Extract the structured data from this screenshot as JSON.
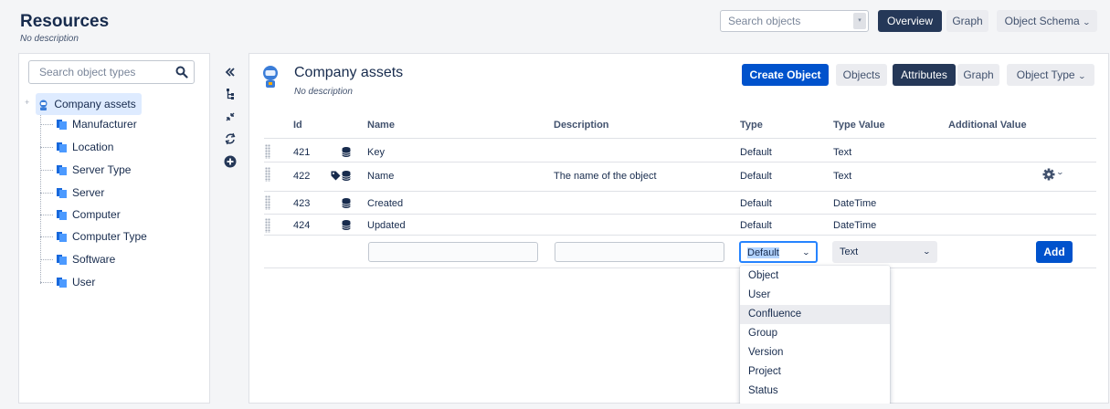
{
  "header": {
    "title": "Resources",
    "description": "No description",
    "search_placeholder": "Search objects",
    "overview_label": "Overview",
    "graph_label": "Graph",
    "schema_label": "Object Schema"
  },
  "sidebar": {
    "search_placeholder": "Search object types",
    "root": {
      "label": "Company assets",
      "icon": "astronaut-icon"
    },
    "items": [
      {
        "label": "Manufacturer",
        "icon": "folder-icon"
      },
      {
        "label": "Location",
        "icon": "folder-icon"
      },
      {
        "label": "Server Type",
        "icon": "folder-icon"
      },
      {
        "label": "Server",
        "icon": "folder-icon"
      },
      {
        "label": "Computer",
        "icon": "folder-icon"
      },
      {
        "label": "Computer Type",
        "icon": "folder-icon"
      },
      {
        "label": "Software",
        "icon": "folder-icon"
      },
      {
        "label": "User",
        "icon": "folder-icon"
      }
    ]
  },
  "rail": [
    "collapse-icon",
    "tree-icon",
    "compress-icon",
    "refresh-icon",
    "add-circle-icon"
  ],
  "main": {
    "title": "Company assets",
    "description": "No description",
    "create_label": "Create Object",
    "tabs": {
      "objects": "Objects",
      "attributes": "Attributes",
      "graph": "Graph",
      "object_type": "Object Type"
    },
    "columns": {
      "id": "Id",
      "name": "Name",
      "description": "Description",
      "type": "Type",
      "type_value": "Type Value",
      "additional_value": "Additional Value"
    },
    "rows": [
      {
        "id": "421",
        "name": "Key",
        "description": "",
        "type": "Default",
        "type_value": "Text"
      },
      {
        "id": "422",
        "name": "Name",
        "description": "The name of the object",
        "type": "Default",
        "type_value": "Text"
      },
      {
        "id": "423",
        "name": "Created",
        "description": "",
        "type": "Default",
        "type_value": "DateTime"
      },
      {
        "id": "424",
        "name": "Updated",
        "description": "",
        "type": "Default",
        "type_value": "DateTime"
      }
    ],
    "new_row": {
      "name_value": "",
      "description_value": "",
      "type_selected": "Default",
      "type_value_selected": "Text",
      "add_label": "Add"
    },
    "type_options": [
      "Object",
      "User",
      "Confluence",
      "Group",
      "Version",
      "Project",
      "Status"
    ],
    "highlighted_option": "Confluence"
  },
  "colors": {
    "primary": "#0052cc",
    "active_tab": "#253858",
    "selection": "#deebff",
    "focus": "#2684ff"
  }
}
